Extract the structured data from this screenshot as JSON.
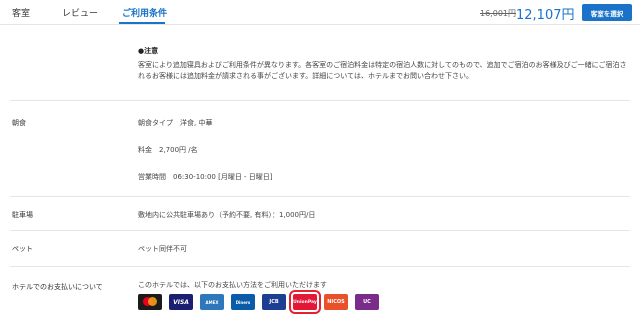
{
  "header": {
    "tabs": [
      {
        "label": "客室"
      },
      {
        "label": "レビュー"
      },
      {
        "label": "ご利用条件"
      }
    ],
    "price_old": "16,001円",
    "price_new": "12,107円",
    "select_label": "客室を選択"
  },
  "notice": {
    "title": "●注意",
    "body": "客室により追加寝具およびご利用条件が異なります。各客室のご宿泊料金は特定の宿泊人数に対してのもので、追加でご宿泊のお客様及びご一緒にご宿泊されるお客様には追加料金が請求される事がございます。詳細については、ホテルまでお問い合わせ下さい。"
  },
  "breakfast": {
    "label": "朝食",
    "type": "朝食タイプ　洋食, 中華",
    "price": "料金　2,700円 /名",
    "hours": "営業時間　06:30-10:00 [月曜日 - 日曜日]"
  },
  "parking": {
    "label": "駐車場",
    "text": "敷地内に公共駐車場あり（予約不要, 有料）：1,000円/日"
  },
  "pets": {
    "label": "ペット",
    "text": "ペット同伴不可"
  },
  "payment": {
    "label": "ホテルでのお支払いについて",
    "text": "このホテルでは、以下のお支払い方法をご利用いただけます",
    "cards": [
      {
        "icon": "mastercard-icon",
        "text": ""
      },
      {
        "icon": "visa-icon",
        "text": "VISA"
      },
      {
        "icon": "amex-icon",
        "text": "AMEX"
      },
      {
        "icon": "diners-icon",
        "text": "Diners"
      },
      {
        "icon": "jcb-icon",
        "text": "JCB"
      },
      {
        "icon": "unionpay-icon",
        "text": "UnionPay"
      },
      {
        "icon": "nicos-icon",
        "text": "NICOS"
      },
      {
        "icon": "uc-icon",
        "text": "UC"
      }
    ]
  }
}
